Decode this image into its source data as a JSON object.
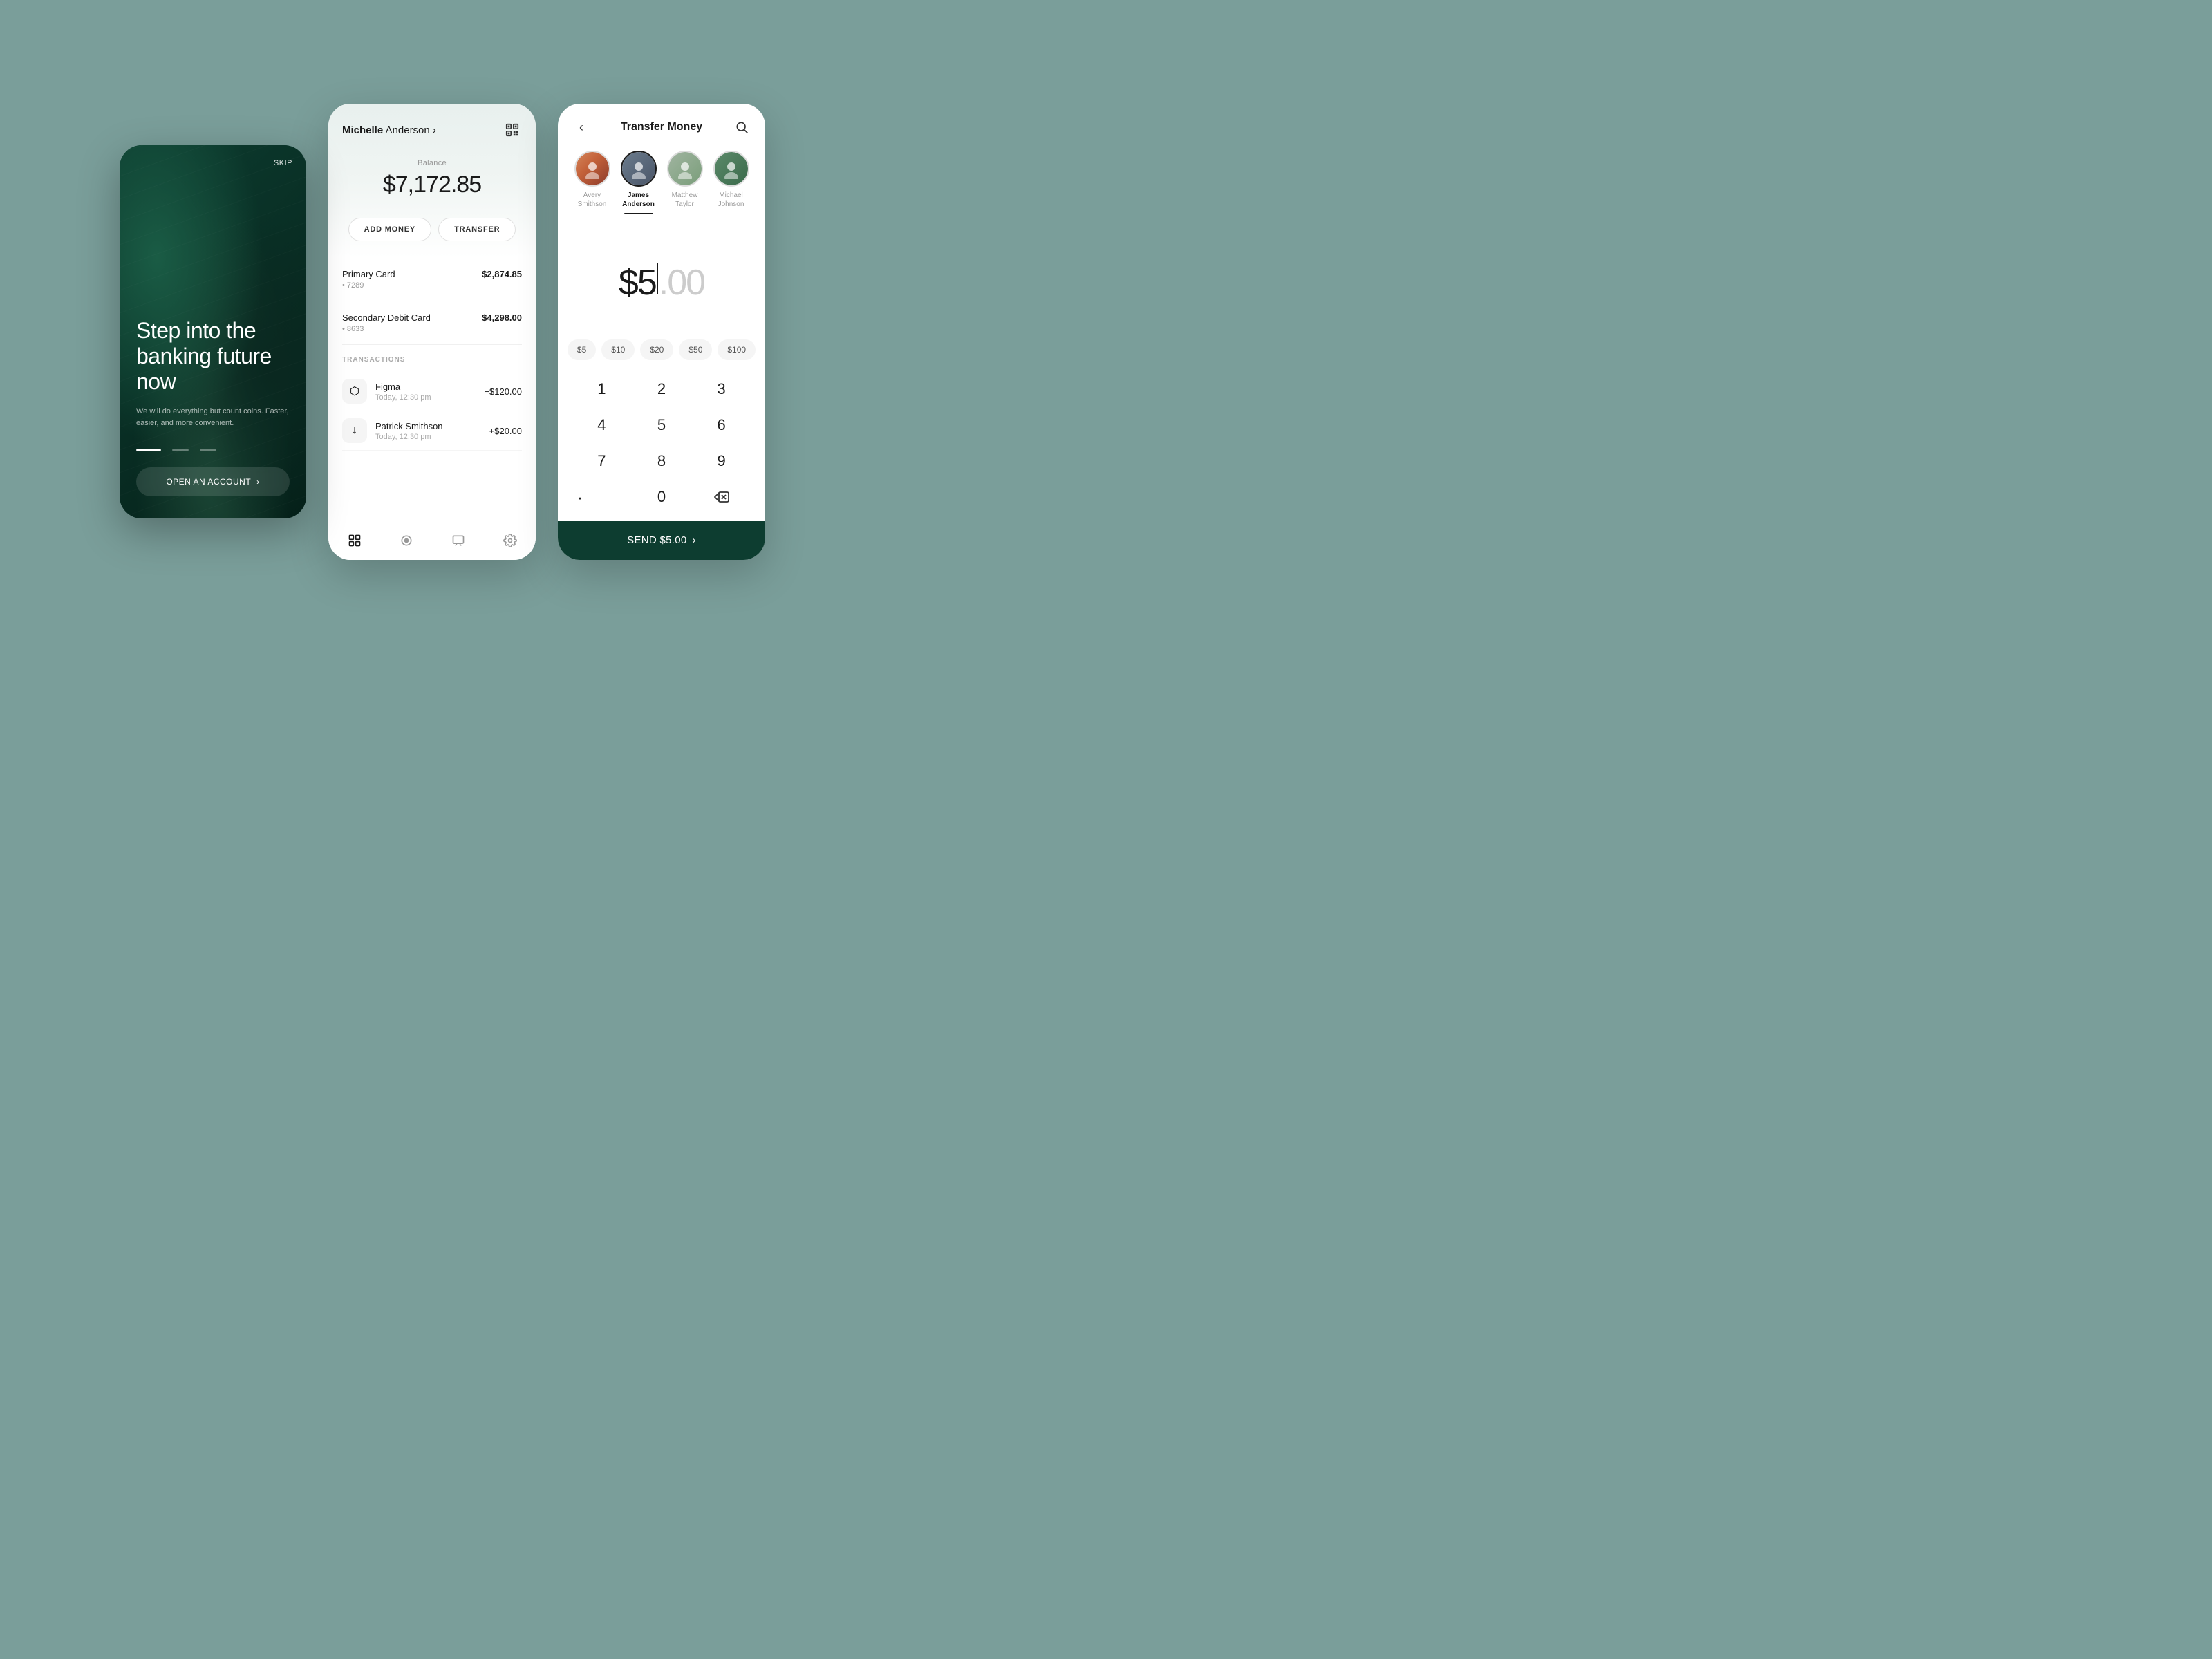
{
  "background": "#7a9e9a",
  "screen1": {
    "skip_label": "SKIP",
    "headline": "Step into the banking future now",
    "subtitle": "We will do everything but count coins. Faster, easier, and more convenient.",
    "cta_label": "OPEN AN ACCOUNT",
    "cta_arrow": "›"
  },
  "screen2": {
    "user_first": "Michelle",
    "user_last": "Anderson",
    "user_arrow": "›",
    "balance_label": "Balance",
    "balance_amount": "$7,172.85",
    "btn_add": "ADD MONEY",
    "btn_transfer": "TRANSFER",
    "cards": [
      {
        "name": "Primary Card",
        "number": "• 7289",
        "amount": "$2,874.85"
      },
      {
        "name": "Secondary Debit Card",
        "number": "• 8633",
        "amount": "$4,298.00"
      }
    ],
    "transactions_label": "TRANSACTIONS",
    "transactions": [
      {
        "icon": "⬡",
        "name": "Figma",
        "date": "Today, 12:30 pm",
        "amount": "−$120.00",
        "type": "negative"
      },
      {
        "icon": "↓",
        "name": "Patrick Smithson",
        "date": "Today, 12:30 pm",
        "amount": "+$20.00",
        "type": "positive"
      }
    ],
    "nav_items": [
      "grid",
      "circle",
      "chat",
      "gear"
    ]
  },
  "screen3": {
    "title": "Transfer Money",
    "contacts": [
      {
        "name": "Avery\nSmithson",
        "selected": false,
        "id": "avery"
      },
      {
        "name": "James\nAnderson",
        "selected": true,
        "id": "james"
      },
      {
        "name": "Matthew\nTaylor",
        "selected": false,
        "id": "matthew"
      },
      {
        "name": "Michael\nJohnson",
        "selected": false,
        "id": "michael"
      }
    ],
    "amount_main": "$5",
    "amount_decimal": ".00",
    "quick_amounts": [
      "$5",
      "$10",
      "$20",
      "$50",
      "$100"
    ],
    "numpad": [
      "1",
      "2",
      "3",
      "4",
      "5",
      "6",
      "7",
      "8",
      "9",
      ".",
      "0",
      "⌫"
    ],
    "send_label": "SEND $5.00",
    "send_arrow": "›"
  }
}
